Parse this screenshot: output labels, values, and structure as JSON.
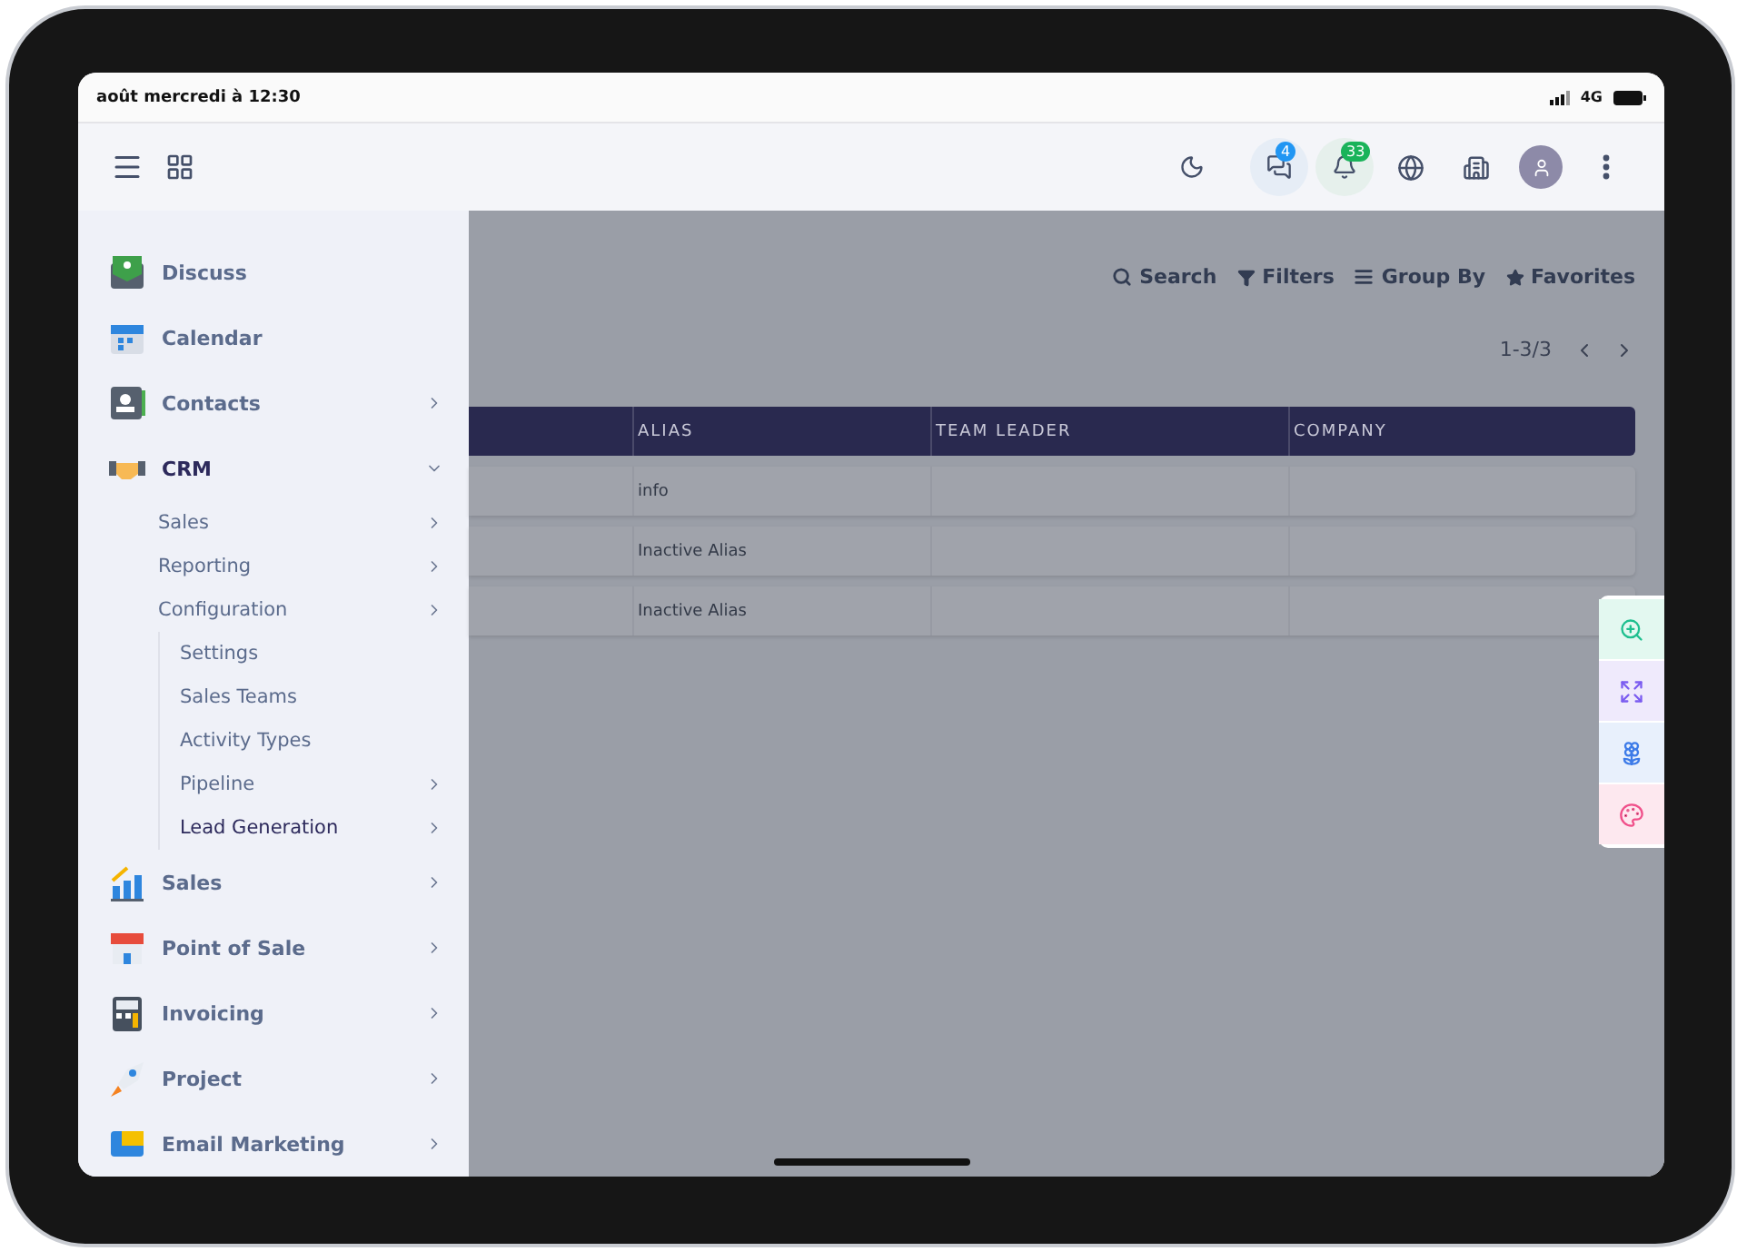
{
  "status_bar": {
    "datetime": "août mercredi à 12:30",
    "network": "4G"
  },
  "top_bar": {
    "chat_badge": "4",
    "notification_badge": "33"
  },
  "sidebar": {
    "items": [
      {
        "kind": "app",
        "label": "Discuss",
        "has_submenu": false,
        "expanded": false
      },
      {
        "kind": "app",
        "label": "Calendar",
        "has_submenu": false,
        "expanded": false
      },
      {
        "kind": "app",
        "label": "Contacts",
        "has_submenu": true,
        "expanded": false
      },
      {
        "kind": "app",
        "label": "CRM",
        "has_submenu": true,
        "expanded": true,
        "children": [
          {
            "label": "Sales",
            "has_submenu": true,
            "selected": false
          },
          {
            "label": "Reporting",
            "has_submenu": true,
            "selected": false
          },
          {
            "label": "Configuration",
            "has_submenu": true,
            "selected": false,
            "children": [
              {
                "label": "Settings",
                "has_submenu": false,
                "selected": false
              },
              {
                "label": "Sales Teams",
                "has_submenu": false,
                "selected": false
              },
              {
                "label": "Activity Types",
                "has_submenu": false,
                "selected": false
              },
              {
                "label": "Pipeline",
                "has_submenu": true,
                "selected": false
              },
              {
                "label": "Lead Generation",
                "has_submenu": true,
                "selected": true
              }
            ]
          }
        ]
      },
      {
        "kind": "app",
        "label": "Sales",
        "has_submenu": true,
        "expanded": false
      },
      {
        "kind": "app",
        "label": "Point of Sale",
        "has_submenu": true,
        "expanded": false
      },
      {
        "kind": "app",
        "label": "Invoicing",
        "has_submenu": true,
        "expanded": false
      },
      {
        "kind": "app",
        "label": "Project",
        "has_submenu": true,
        "expanded": false
      },
      {
        "kind": "app",
        "label": "Email Marketing",
        "has_submenu": true,
        "expanded": false
      }
    ]
  },
  "search_bar": {
    "actions": [
      {
        "label": "Search"
      },
      {
        "label": "Filters"
      },
      {
        "label": "Group By"
      },
      {
        "label": "Favorites"
      }
    ]
  },
  "pager": {
    "range": "1-3/3"
  },
  "table": {
    "columns": [
      "",
      "ALIAS",
      "TEAM LEADER",
      "COMPANY"
    ],
    "rows": [
      [
        "",
        "info",
        "",
        ""
      ],
      [
        "",
        "Inactive Alias",
        "",
        ""
      ],
      [
        "",
        "Inactive Alias",
        "",
        ""
      ]
    ]
  },
  "side_tools": [
    {
      "color": "#e3f8f0"
    },
    {
      "color": "#efeafc"
    },
    {
      "color": "#e8f0fc"
    },
    {
      "color": "#fde8ef"
    }
  ]
}
